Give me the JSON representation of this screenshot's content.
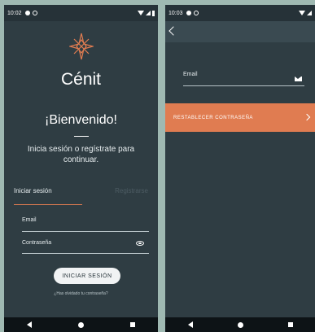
{
  "left": {
    "status": {
      "time": "10:02"
    },
    "brand": "Cénit",
    "welcome": "¡Bienvenido!",
    "subtitle": "Inicia sesión o regístrate para continuar.",
    "tabs": [
      {
        "label": "Iniciar sesión"
      },
      {
        "label": "Registrarse"
      }
    ],
    "email_label": "Email",
    "password_label": "Contraseña",
    "login_button": "INICIAR SESIÓN",
    "forgot_link": "¿Has olvidado tu contraseña?"
  },
  "right": {
    "status": {
      "time": "10:03"
    },
    "email_label": "Email",
    "reset_button": "RESTABLECER CONTRASEÑA"
  },
  "colors": {
    "background": "#9fb9b2",
    "screen": "#2f3d43",
    "accent": "#e07c51",
    "navbar": "#0d1316"
  }
}
